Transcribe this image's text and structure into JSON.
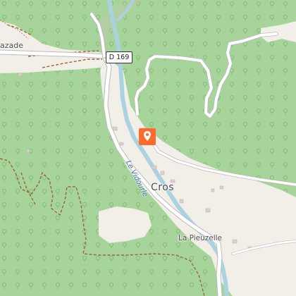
{
  "map": {
    "places": {
      "cros": "Cros",
      "la_pieuzelle": "La Pieuzelle",
      "azade": "azade"
    },
    "road_ref": "D 169",
    "river_name": "Le Vidourle",
    "marker_icon": "map-pin-icon",
    "colors": {
      "forest": "#a7d49a",
      "clearing": "#f2efe9",
      "water": "#aad3df",
      "road": "#ffffff",
      "road_casing": "#bbbbbb",
      "track": "#996633",
      "marker": "#ff6b2c",
      "building": "#d9d0c9"
    }
  }
}
